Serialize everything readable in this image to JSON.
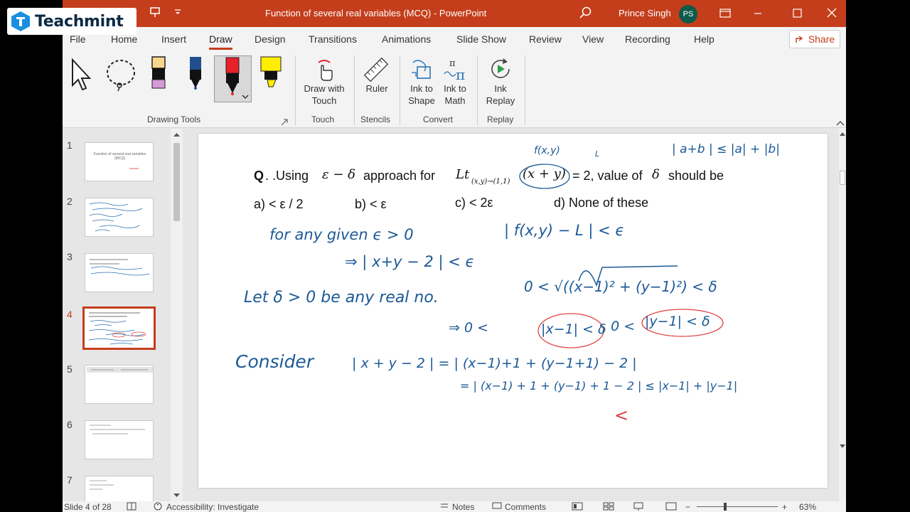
{
  "watermark": {
    "text": "Teachmint"
  },
  "window": {
    "title": "Function of several real variables (MCQ)  -  PowerPoint",
    "user_name": "Prince Singh",
    "user_initials": "PS"
  },
  "tabs": [
    "File",
    "Home",
    "Insert",
    "Draw",
    "Design",
    "Transitions",
    "Animations",
    "Slide Show",
    "Review",
    "View",
    "Recording",
    "Help"
  ],
  "active_tab": "Draw",
  "share_label": "Share",
  "ribbon": {
    "groups": {
      "drawing_tools": "Drawing Tools",
      "touch": "Touch",
      "stencils": "Stencils",
      "convert": "Convert",
      "replay": "Replay"
    },
    "buttons": {
      "draw_with_touch_1": "Draw with",
      "draw_with_touch_2": "Touch",
      "ruler": "Ruler",
      "ink_to_shape_1": "Ink to",
      "ink_to_shape_2": "Shape",
      "ink_to_math_1": "Ink to",
      "ink_to_math_2": "Math",
      "ink_replay_1": "Ink",
      "ink_replay_2": "Replay"
    },
    "pen_colors": [
      "#f7d78b",
      "#1e4f8c",
      "#e8202a",
      "#ffee00"
    ]
  },
  "thumbnails": [
    {
      "num": "1",
      "caption": "Function of several real variables (MCQ)"
    },
    {
      "num": "2",
      "caption": ""
    },
    {
      "num": "3",
      "caption": ""
    },
    {
      "num": "4",
      "caption": ""
    },
    {
      "num": "5",
      "caption": ""
    },
    {
      "num": "6",
      "caption": ""
    },
    {
      "num": "7",
      "caption": ""
    }
  ],
  "active_slide": "4",
  "slide": {
    "question_prefix": "Q",
    "question_using": ". .Using",
    "question_eps_delta": "ε − δ",
    "question_approach": "approach  for",
    "question_lt": "Lt",
    "question_sub": "(x,y)→(1,1)",
    "question_fn": "(x + y)",
    "question_eq": "= 2, value of",
    "question_delta": "δ",
    "question_suffix": "should be",
    "options": [
      "a) < ε / 2",
      "b) < ε",
      "c) < 2ε",
      "d) None of these"
    ],
    "ink_lines": [
      "f(x,y)",
      "L",
      "| a+b | ≤ |a| + |b|",
      "for  any  given  ϵ > 0",
      "| f(x,y) − L | < ϵ",
      "⇒   | x+y − 2 | < ϵ",
      "Let  δ > 0  be  any  real no.",
      "0 < √((x−1)² + (y−1)²)  < δ",
      "⇒   0 <",
      "|x−1| < δ",
      ",  0 <",
      "|y−1| < δ",
      "Consider",
      "| x + y − 2 | = | (x−1)+1 + (y−1+1) − 2 |",
      "= | (x−1) + 1 + (y−1) + 1 − 2 |  ≤  |x−1| + |y−1|",
      "<"
    ]
  },
  "status": {
    "slide_info": "Slide 4 of 28",
    "accessibility": "Accessibility: Investigate",
    "notes": "Notes",
    "comments": "Comments",
    "zoom": "63%"
  }
}
